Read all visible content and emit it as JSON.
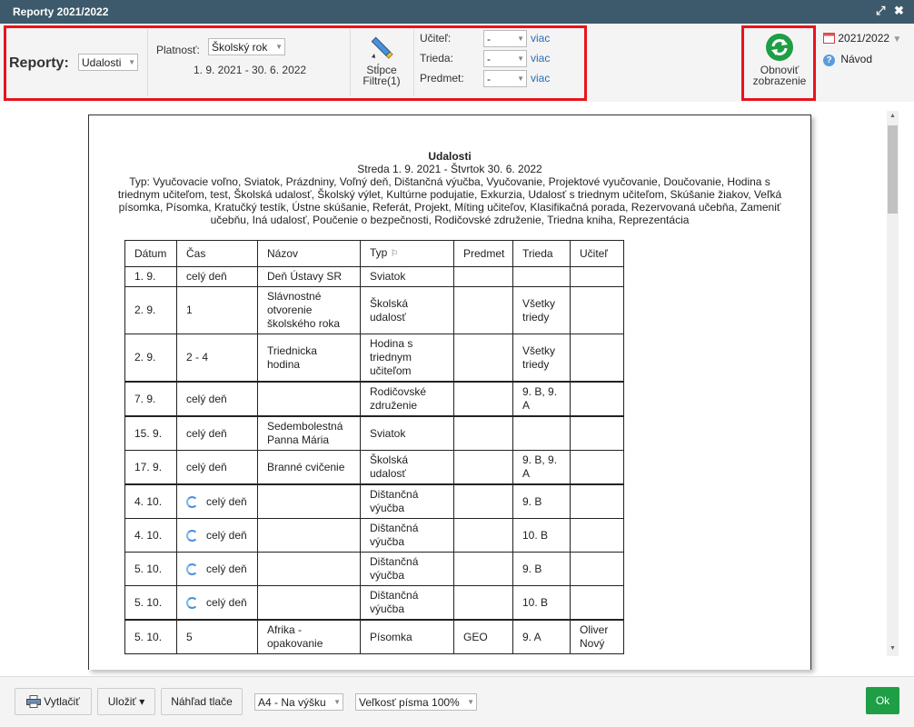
{
  "window": {
    "title": "Reporty 2021/2022",
    "restore_glyph": "⤢",
    "close_glyph": "✖"
  },
  "toolbar": {
    "reports_label": "Reporty:",
    "report_type": "Udalosti",
    "validity_label": "Platnosť:",
    "validity_value": "Školský rok",
    "date_range": "1. 9. 2021 - 30. 6. 2022",
    "columns_filters_line1": "Stĺpce",
    "columns_filters_line2": "Filtre(1)",
    "filters": [
      {
        "label": "Učiteľ:",
        "value": "-",
        "link": "viac"
      },
      {
        "label": "Trieda:",
        "value": "-",
        "link": "viac"
      },
      {
        "label": "Predmet:",
        "value": "-",
        "link": "viac"
      }
    ],
    "refresh_line1": "Obnoviť",
    "refresh_line2": "zobrazenie",
    "school_year": "2021/2022",
    "guide": "Návod"
  },
  "document": {
    "title": "Udalosti",
    "subtitle": "Streda 1. 9. 2021 - Štvrtok 30. 6. 2022",
    "types_line": "Typ: Vyučovacie voľno, Sviatok, Prázdniny, Voľný deň, Dištančná výučba, Vyučovanie, Projektové vyučovanie, Doučovanie, Hodina s triednym učiteľom, test, Školská udalosť, Školský výlet, Kultúrne podujatie, Exkurzia, Udalosť s triednym učiteľom, Skúšanie žiakov, Veľká písomka, Písomka, Kratučký testík, Ústne skúšanie, Referát, Projekt, Míting učiteľov, Klasifikačná porada, Rezervovaná učebňa, Zameniť učebňu, Iná udalosť, Poučenie o bezpečnosti, Rodičovské združenie, Triedna kniha, Reprezentácia",
    "columns": [
      "Dátum",
      "Čas",
      "Názov",
      "Typ",
      "Predmet",
      "Trieda",
      "Učiteľ"
    ],
    "sort_glyph": "⚐",
    "rows": [
      {
        "date": "1. 9.",
        "time": "celý deň",
        "name": "Deň Ústavy SR",
        "type": "Sviatok",
        "subject": "",
        "class": "",
        "teacher": "",
        "repeat": false,
        "thick": false
      },
      {
        "date": "2. 9.",
        "time": "1",
        "name": "Slávnostné otvorenie školského roka",
        "type": "Školská udalosť",
        "subject": "",
        "class": "Všetky triedy",
        "teacher": "",
        "repeat": false,
        "thick": false
      },
      {
        "date": "2. 9.",
        "time": "2 - 4",
        "name": "Triednicka hodina",
        "type": "Hodina s triednym učiteľom",
        "subject": "",
        "class": "Všetky triedy",
        "teacher": "",
        "repeat": false,
        "thick": false
      },
      {
        "date": "7. 9.",
        "time": "celý deň",
        "name": "",
        "type": "Rodičovské združenie",
        "subject": "",
        "class": "9. B, 9. A",
        "teacher": "",
        "repeat": false,
        "thick": true
      },
      {
        "date": "15. 9.",
        "time": "celý deň",
        "name": "Sedembolestná Panna Mária",
        "type": "Sviatok",
        "subject": "",
        "class": "",
        "teacher": "",
        "repeat": false,
        "thick": true
      },
      {
        "date": "17. 9.",
        "time": "celý deň",
        "name": "Branné cvičenie",
        "type": "Školská udalosť",
        "subject": "",
        "class": "9. B, 9. A",
        "teacher": "",
        "repeat": false,
        "thick": false
      },
      {
        "date": "4. 10.",
        "time": "celý deň",
        "name": "",
        "type": "Dištančná výučba",
        "subject": "",
        "class": "9. B",
        "teacher": "",
        "repeat": true,
        "thick": true
      },
      {
        "date": "4. 10.",
        "time": "celý deň",
        "name": "",
        "type": "Dištančná výučba",
        "subject": "",
        "class": "10. B",
        "teacher": "",
        "repeat": true,
        "thick": false
      },
      {
        "date": "5. 10.",
        "time": "celý deň",
        "name": "",
        "type": "Dištančná výučba",
        "subject": "",
        "class": "9. B",
        "teacher": "",
        "repeat": true,
        "thick": false
      },
      {
        "date": "5. 10.",
        "time": "celý deň",
        "name": "",
        "type": "Dištančná výučba",
        "subject": "",
        "class": "10. B",
        "teacher": "",
        "repeat": true,
        "thick": false
      },
      {
        "date": "5. 10.",
        "time": "5",
        "name": "Afrika - opakovanie",
        "type": "Písomka",
        "subject": "GEO",
        "class": "9. A",
        "teacher": "Oliver Nový",
        "repeat": false,
        "thick": true
      }
    ]
  },
  "footer": {
    "print": "Vytlačiť",
    "save": "Uložiť ▾",
    "preview": "Náhľad tlače",
    "paper": "A4 - Na výšku",
    "font_size": "Veľkosť písma 100%",
    "ok": "Ok"
  },
  "colors": {
    "titlebar": "#3d5a6c",
    "highlight": "#e8141e",
    "link": "#2a6db5",
    "ok": "#1e9e45"
  }
}
